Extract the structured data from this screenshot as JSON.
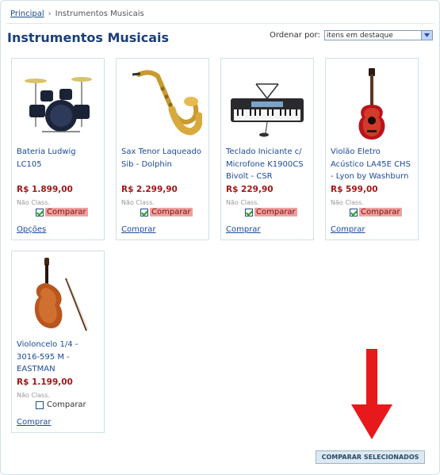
{
  "breadcrumb": {
    "home": "Principal",
    "separator": "›",
    "current": "Instrumentos Musicais"
  },
  "page": {
    "title": "Instrumentos Musicais"
  },
  "sort": {
    "label": "Ordenar por:",
    "selected": "itens em destaque"
  },
  "products": [
    {
      "name": "Bateria Ludwig LC105",
      "price": "R$ 1.899,00",
      "rating": "Não Class.",
      "compare_label": "Comparar",
      "compare_checked": true,
      "link": "Opções",
      "icon": "drum-kit-image"
    },
    {
      "name": "Sax Tenor Laqueado Sib - Dolphin",
      "price": "R$ 2.299,90",
      "rating": "Não Class.",
      "compare_label": "Comparar",
      "compare_checked": true,
      "link": "Comprar",
      "icon": "saxophone-image"
    },
    {
      "name": "Teclado Iniciante c/ Microfone K1900CS Bivolt - CSR",
      "price": "R$ 229,90",
      "rating": "Não Class.",
      "compare_label": "Comparar",
      "compare_checked": true,
      "link": "Comprar",
      "icon": "keyboard-image"
    },
    {
      "name": "Violão Eletro Acústico LA45E CHS - Lyon by Washburn",
      "price": "R$ 599,00",
      "rating": "Não Class.",
      "compare_label": "Comparar",
      "compare_checked": true,
      "link": "Comprar",
      "icon": "guitar-image"
    },
    {
      "name": "Violoncelo 1/4 - 3016-595 M - EASTMAN",
      "price": "R$ 1.199,00",
      "rating": "Não Class.",
      "compare_label": "Comparar",
      "compare_checked": false,
      "link": "Comprar",
      "icon": "cello-image"
    }
  ],
  "compare_button": {
    "label": "COMPARAR SELECIONADOS"
  },
  "colors": {
    "title": "#1a3f7a",
    "price": "#a01818",
    "highlight": "#f1a0a0",
    "arrow": "#e8191c"
  }
}
